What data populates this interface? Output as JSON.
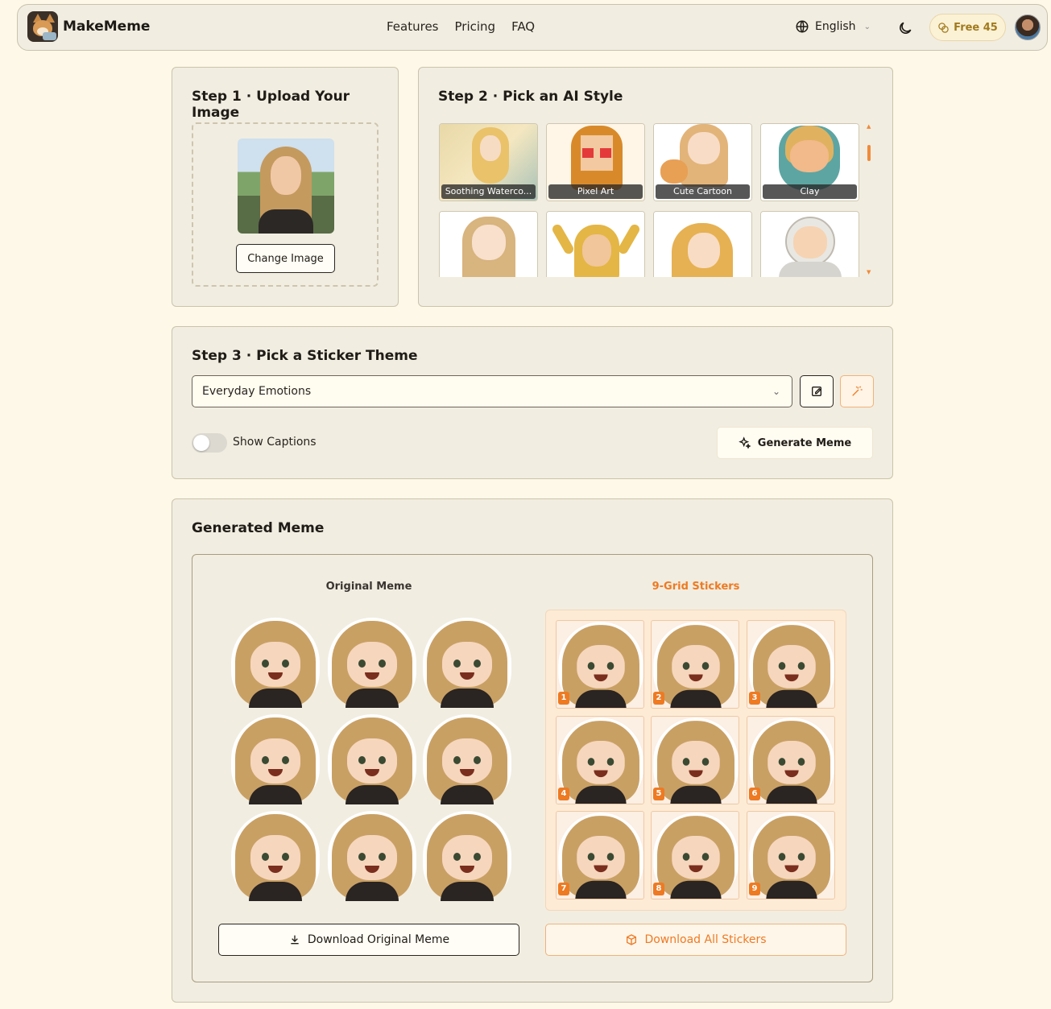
{
  "header": {
    "brand": "MakeMeme",
    "nav": [
      "Features",
      "Pricing",
      "FAQ"
    ],
    "language": "English",
    "credits": "Free 45"
  },
  "step1": {
    "title": "Step 1 · Upload Your Image",
    "change_button": "Change Image"
  },
  "step2": {
    "title": "Step 2 · Pick an AI Style",
    "styles": [
      "Soothing Waterco...",
      "Pixel Art",
      "Cute Cartoon",
      "Clay"
    ]
  },
  "step3": {
    "title": "Step 3 · Pick a Sticker Theme",
    "theme_value": "Everyday Emotions",
    "captions_label": "Show Captions",
    "captions_on": false,
    "generate_button": "Generate Meme"
  },
  "result": {
    "title": "Generated Meme",
    "original_title": "Original Meme",
    "grid_title": "9-Grid Stickers",
    "sticker_numbers": [
      "1",
      "2",
      "3",
      "4",
      "5",
      "6",
      "7",
      "8",
      "9"
    ],
    "download_original": "Download Original Meme",
    "download_all": "Download All Stickers"
  },
  "colors": {
    "accent": "#ee7a22",
    "page_bg": "#fdf8e8",
    "card_bg": "#f1ede1",
    "credits_text": "#a17a1e"
  }
}
